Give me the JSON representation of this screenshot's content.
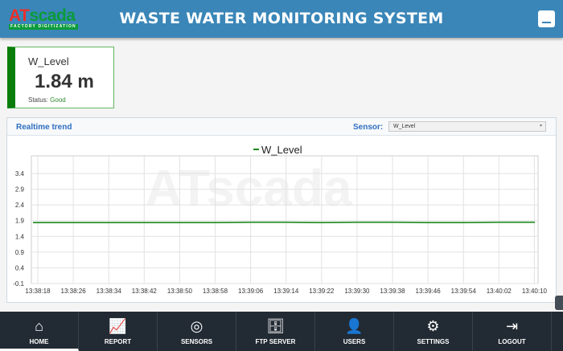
{
  "header": {
    "logo_text_red": "AT",
    "logo_text_green": "scada",
    "logo_tagline": "FACTORY DIGITIZATION",
    "title": "WASTE WATER MONITORING SYSTEM",
    "minimize_icon": "minimize-icon"
  },
  "card": {
    "name": "W_Level",
    "value": "1.84",
    "unit": "m",
    "status_label": "Status:",
    "status_value": "Good"
  },
  "panel": {
    "title": "Realtime trend",
    "sensor_label": "Sensor:",
    "sensor_selected": "W_Level"
  },
  "chart_data": {
    "type": "line",
    "title": "",
    "legend": [
      "W_Level"
    ],
    "legend_placement": "top-center",
    "xlabel": "",
    "ylabel": "",
    "x": [
      "13:38:18",
      "13:38:26",
      "13:38:34",
      "13:38:42",
      "13:38:50",
      "13:38:58",
      "13:39:06",
      "13:39:14",
      "13:39:22",
      "13:39:30",
      "13:39:38",
      "13:39:46",
      "13:39:54",
      "13:40:02",
      "13:40:10"
    ],
    "yticks": [
      -0.1,
      0.4,
      0.9,
      1.4,
      1.9,
      2.4,
      2.9,
      3.4
    ],
    "ylim": [
      -0.1,
      3.4
    ],
    "grid": true,
    "series": [
      {
        "name": "W_Level",
        "color": "#1a8a1a",
        "values": [
          1.84,
          1.84,
          1.84,
          1.84,
          1.84,
          1.84,
          1.85,
          1.85,
          1.84,
          1.85,
          1.85,
          1.84,
          1.84,
          1.85,
          1.85
        ]
      }
    ],
    "watermark": "ATscada"
  },
  "nav": [
    {
      "label": "HOME",
      "icon": "home-icon",
      "glyph": "⌂"
    },
    {
      "label": "REPORT",
      "icon": "report-icon",
      "glyph": "📈"
    },
    {
      "label": "SENSORS",
      "icon": "sensor-icon",
      "glyph": "◎"
    },
    {
      "label": "FTP SERVER",
      "icon": "server-icon",
      "glyph": "🗄"
    },
    {
      "label": "USERS",
      "icon": "user-icon",
      "glyph": "👤"
    },
    {
      "label": "SETTINGS",
      "icon": "gear-icon",
      "glyph": "⚙"
    },
    {
      "label": "LOGOUT",
      "icon": "logout-icon",
      "glyph": "⇥"
    }
  ]
}
